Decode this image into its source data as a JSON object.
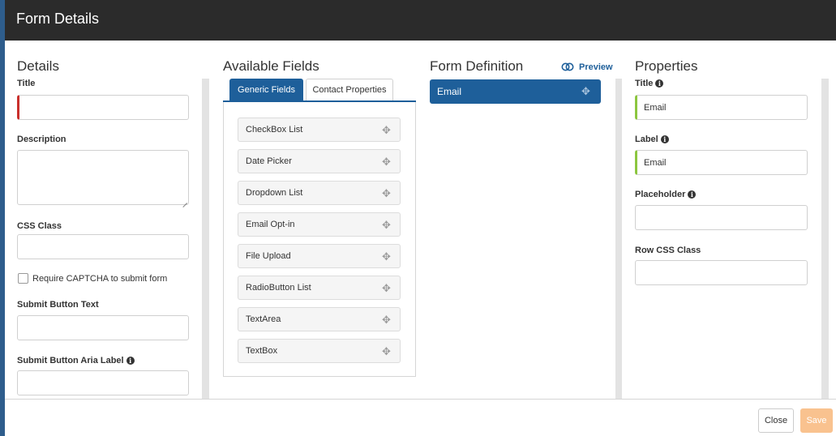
{
  "dialog": {
    "title": "Form Details"
  },
  "details": {
    "heading": "Details",
    "title_label": "Title",
    "title_value": "",
    "description_label": "Description",
    "description_value": "",
    "css_class_label": "CSS Class",
    "css_class_value": "",
    "captcha_label": "Require CAPTCHA to submit form",
    "captcha_checked": false,
    "submit_text_label": "Submit Button Text",
    "submit_text_value": "",
    "submit_aria_label": "Submit Button Aria Label",
    "submit_aria_value": ""
  },
  "available_fields": {
    "heading": "Available Fields",
    "tabs": [
      {
        "label": "Generic Fields",
        "active": true
      },
      {
        "label": "Contact Properties",
        "active": false
      }
    ],
    "items": [
      {
        "label": "CheckBox List"
      },
      {
        "label": "Date Picker"
      },
      {
        "label": "Dropdown List"
      },
      {
        "label": "Email Opt-in"
      },
      {
        "label": "File Upload"
      },
      {
        "label": "RadioButton List"
      },
      {
        "label": "TextArea"
      },
      {
        "label": "TextBox"
      }
    ]
  },
  "form_definition": {
    "heading": "Form Definition",
    "preview_label": "Preview",
    "items": [
      {
        "label": "Email"
      }
    ]
  },
  "properties": {
    "heading": "Properties",
    "title_label": "Title",
    "title_value": "Email",
    "label_label": "Label",
    "label_value": "Email",
    "placeholder_label": "Placeholder",
    "placeholder_value": "",
    "row_css_label": "Row CSS Class",
    "row_css_value": ""
  },
  "footer": {
    "close_label": "Close",
    "save_label": "Save"
  },
  "icons": {
    "info": "info-icon",
    "drag": "drag-move-icon",
    "preview": "toggle-icon"
  },
  "colors": {
    "accent": "#1e5f9a",
    "required": "#c9302c",
    "valid": "#8cc63f",
    "save_disabled": "#f9c28f",
    "titlebar": "#2b2b2b"
  }
}
